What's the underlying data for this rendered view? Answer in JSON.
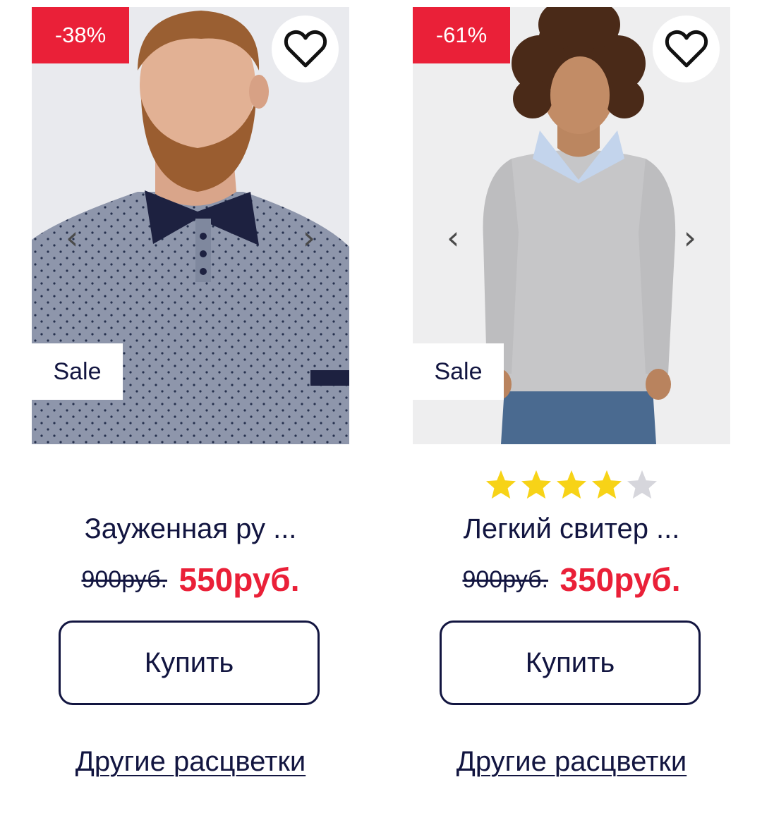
{
  "colors": {
    "accent_red": "#ea2038",
    "navy": "#121540",
    "star_filled": "#f7d317",
    "star_empty": "#d6d6dc"
  },
  "icons": {
    "favorite": "heart-outline-icon",
    "prev": "chevron-left-icon",
    "next": "chevron-right-icon",
    "rating": "star-icon"
  },
  "products": [
    {
      "discount": "-38%",
      "sale_label": "Sale",
      "prev_arrow": "‹",
      "next_arrow": "›",
      "rating": null,
      "title": "Зауженная ру ...",
      "old_price": "900руб.",
      "new_price": "550руб.",
      "buy_label": "Купить",
      "colors_link": "Другие расцветки"
    },
    {
      "discount": "-61%",
      "sale_label": "Sale",
      "prev_arrow": "‹",
      "next_arrow": "›",
      "rating": {
        "value": 4,
        "max": 5
      },
      "title": "Легкий свитер ...",
      "old_price": "900руб.",
      "new_price": "350руб.",
      "buy_label": "Купить",
      "colors_link": "Другие расцветки"
    }
  ]
}
